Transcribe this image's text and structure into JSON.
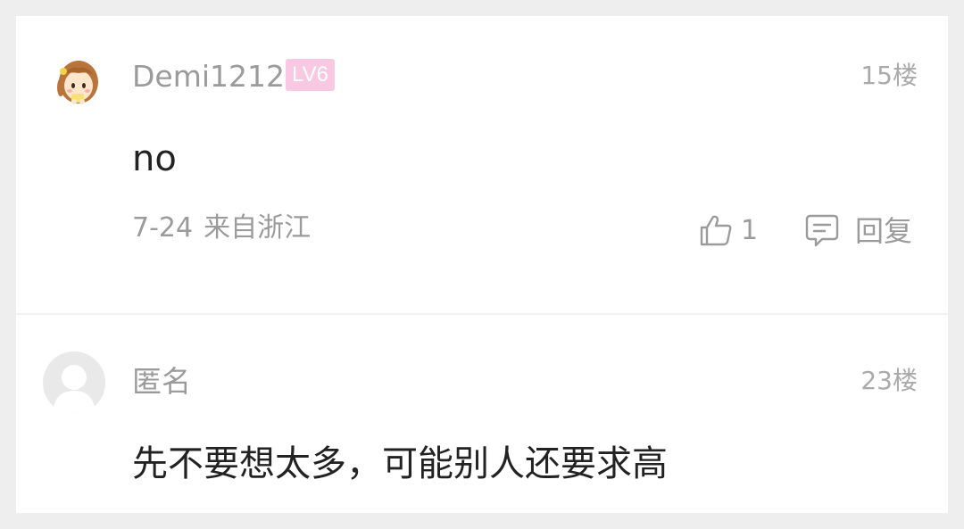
{
  "comments": [
    {
      "username": "Demi1212",
      "level": "LV6",
      "floor": "15楼",
      "content": "no",
      "date": "7-24",
      "location": "来自浙江",
      "like_count": "1",
      "reply_label": "回复",
      "avatar_icon": "cartoon-girl-avatar"
    },
    {
      "username": "匿名",
      "floor": "23楼",
      "content": "先不要想太多，可能别人还要求高",
      "avatar_icon": "anonymous-avatar"
    }
  ],
  "colors": {
    "background": "#eeeeee",
    "card": "#ffffff",
    "level_badge": "#f9c8e2",
    "muted_text": "#9b9b9b",
    "body_text": "#222222"
  },
  "icons": {
    "like": "thumbs-up-icon",
    "reply": "comment-bubble-icon"
  }
}
